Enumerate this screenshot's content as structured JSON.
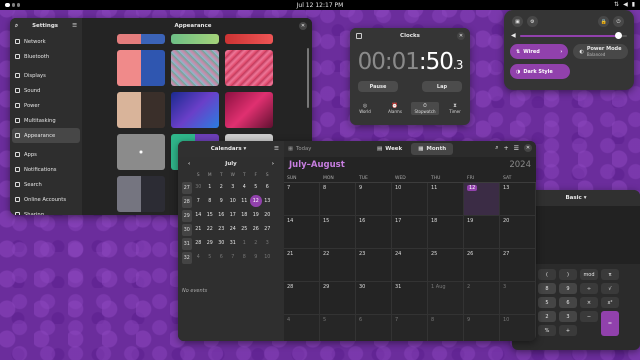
{
  "topbar": {
    "clock": "Jul 12  12:17 PM",
    "tray": [
      "network-icon",
      "volume-icon",
      "battery-icon"
    ]
  },
  "settings": {
    "title": "Settings",
    "page_title": "Appearance",
    "sidebar": [
      {
        "label": "Network",
        "icon": "network-icon"
      },
      {
        "label": "Bluetooth",
        "icon": "bluetooth-icon"
      },
      {
        "label": "Displays",
        "icon": "display-icon"
      },
      {
        "label": "Sound",
        "icon": "sound-icon"
      },
      {
        "label": "Power",
        "icon": "power-icon"
      },
      {
        "label": "Multitasking",
        "icon": "multitasking-icon"
      },
      {
        "label": "Appearance",
        "icon": "appearance-icon",
        "selected": true
      },
      {
        "label": "Apps",
        "icon": "apps-icon"
      },
      {
        "label": "Notifications",
        "icon": "bell-icon"
      },
      {
        "label": "Search",
        "icon": "search-icon"
      },
      {
        "label": "Online Accounts",
        "icon": "accounts-icon"
      },
      {
        "label": "Sharing",
        "icon": "sharing-icon"
      }
    ],
    "wallpapers": [
      {
        "name": "blue-red-thin",
        "bg": "linear-gradient(90deg,#e47d7d 50%,#3b63b7 50%)"
      },
      {
        "name": "pixels-thin",
        "bg": "linear-gradient(90deg,#6dbf86,#a5d37a)"
      },
      {
        "name": "red-thin",
        "bg": "linear-gradient(90deg,#c33,#e55)"
      },
      {
        "name": "pink-blue",
        "bg": "linear-gradient(90deg,#f08a8a 50%,#2f56b0 50%)"
      },
      {
        "name": "pixel-mosaic",
        "bg": "repeating-linear-gradient(45deg,#8bc,#c8a 3px,#6a9 6px)"
      },
      {
        "name": "red-mosaic",
        "bg": "repeating-linear-gradient(-45deg,#d46,#e79 3px,#b35 6px)"
      },
      {
        "name": "sand-drops",
        "bg": "linear-gradient(90deg,#d9b49a 50%,#3a2f2a 50%)"
      },
      {
        "name": "blue-waves",
        "bg": "linear-gradient(135deg,#1a2a8f,#6a3fc8,#2a7ee0)"
      },
      {
        "name": "magenta-waves",
        "bg": "linear-gradient(135deg,#8b1040,#e03070,#601030)"
      },
      {
        "name": "dots-light",
        "bg": "radial-gradient(circle,#fff 1px,#8b8b8b 2px)"
      },
      {
        "name": "teal-purple",
        "bg": "linear-gradient(90deg,#2fb58a 50%,#6c3fb6 50%)"
      },
      {
        "name": "grey-red",
        "bg": "linear-gradient(#ccc 40%,#c33 40%)"
      },
      {
        "name": "grey-dark",
        "bg": "linear-gradient(90deg,#757580 50%,#2c2c34 50%)"
      }
    ]
  },
  "clocks": {
    "title": "Clocks",
    "time": {
      "dim": "00:01",
      "big": ":50",
      "small": ".3"
    },
    "pause_label": "Pause",
    "lap_label": "Lap",
    "tabs": [
      {
        "label": "World",
        "icon": "globe-icon"
      },
      {
        "label": "Alarms",
        "icon": "alarm-icon"
      },
      {
        "label": "Stopwatch",
        "icon": "stopwatch-icon",
        "selected": true
      },
      {
        "label": "Timer",
        "icon": "timer-icon"
      }
    ]
  },
  "quick_settings": {
    "volume_level": 0.92,
    "wired_label": "Wired",
    "power_mode_label": "Power Mode",
    "power_mode_value": "Balanced",
    "dark_style_label": "Dark Style"
  },
  "calendar": {
    "sidebar_title": "Calendars",
    "mini_month": "July",
    "mini_days": [
      "S",
      "M",
      "T",
      "W",
      "T",
      "F",
      "S"
    ],
    "mini_weeks": [
      {
        "wk": "27",
        "days": [
          "30",
          "1",
          "2",
          "3",
          "4",
          "5",
          "6"
        ],
        "muted": [
          0
        ]
      },
      {
        "wk": "28",
        "days": [
          "7",
          "8",
          "9",
          "10",
          "11",
          "12",
          "13"
        ],
        "today": 5
      },
      {
        "wk": "29",
        "days": [
          "14",
          "15",
          "16",
          "17",
          "18",
          "19",
          "20"
        ]
      },
      {
        "wk": "30",
        "days": [
          "21",
          "22",
          "23",
          "24",
          "25",
          "26",
          "27"
        ]
      },
      {
        "wk": "31",
        "days": [
          "28",
          "29",
          "30",
          "31",
          "1",
          "2",
          "3"
        ],
        "muted": [
          4,
          5,
          6
        ]
      },
      {
        "wk": "32",
        "days": [
          "4",
          "5",
          "6",
          "7",
          "8",
          "9",
          "10"
        ],
        "muted": [
          0,
          1,
          2,
          3,
          4,
          5,
          6
        ]
      }
    ],
    "no_events": "No events",
    "today_label": "Today",
    "week_label": "Week",
    "month_label": "Month",
    "month_title": "July–August",
    "year": "2024",
    "day_names": [
      "SUN",
      "MON",
      "TUE",
      "WED",
      "THU",
      "FRI",
      "SAT"
    ],
    "rows": [
      [
        "7",
        "8",
        "9",
        "10",
        "11",
        "12",
        "13"
      ],
      [
        "14",
        "15",
        "16",
        "17",
        "18",
        "19",
        "20"
      ],
      [
        "21",
        "22",
        "23",
        "24",
        "25",
        "26",
        "27"
      ],
      [
        "28",
        "29",
        "30",
        "31",
        "1 Aug",
        "2",
        "3"
      ],
      [
        "4",
        "5",
        "6",
        "7",
        "8",
        "9",
        "10"
      ]
    ]
  },
  "calculator": {
    "mode": "Basic",
    "keys": [
      "(",
      ")",
      "mod",
      "π",
      "8",
      "9",
      "÷",
      "√",
      "5",
      "6",
      "×",
      "x²",
      "2",
      "3",
      "−",
      "",
      "",
      "%",
      "+"
    ],
    "equals": "="
  },
  "colors": {
    "accent": "#9141ac",
    "accent_text": "#c77ee0",
    "wallpaper": "#6b2d9c"
  }
}
